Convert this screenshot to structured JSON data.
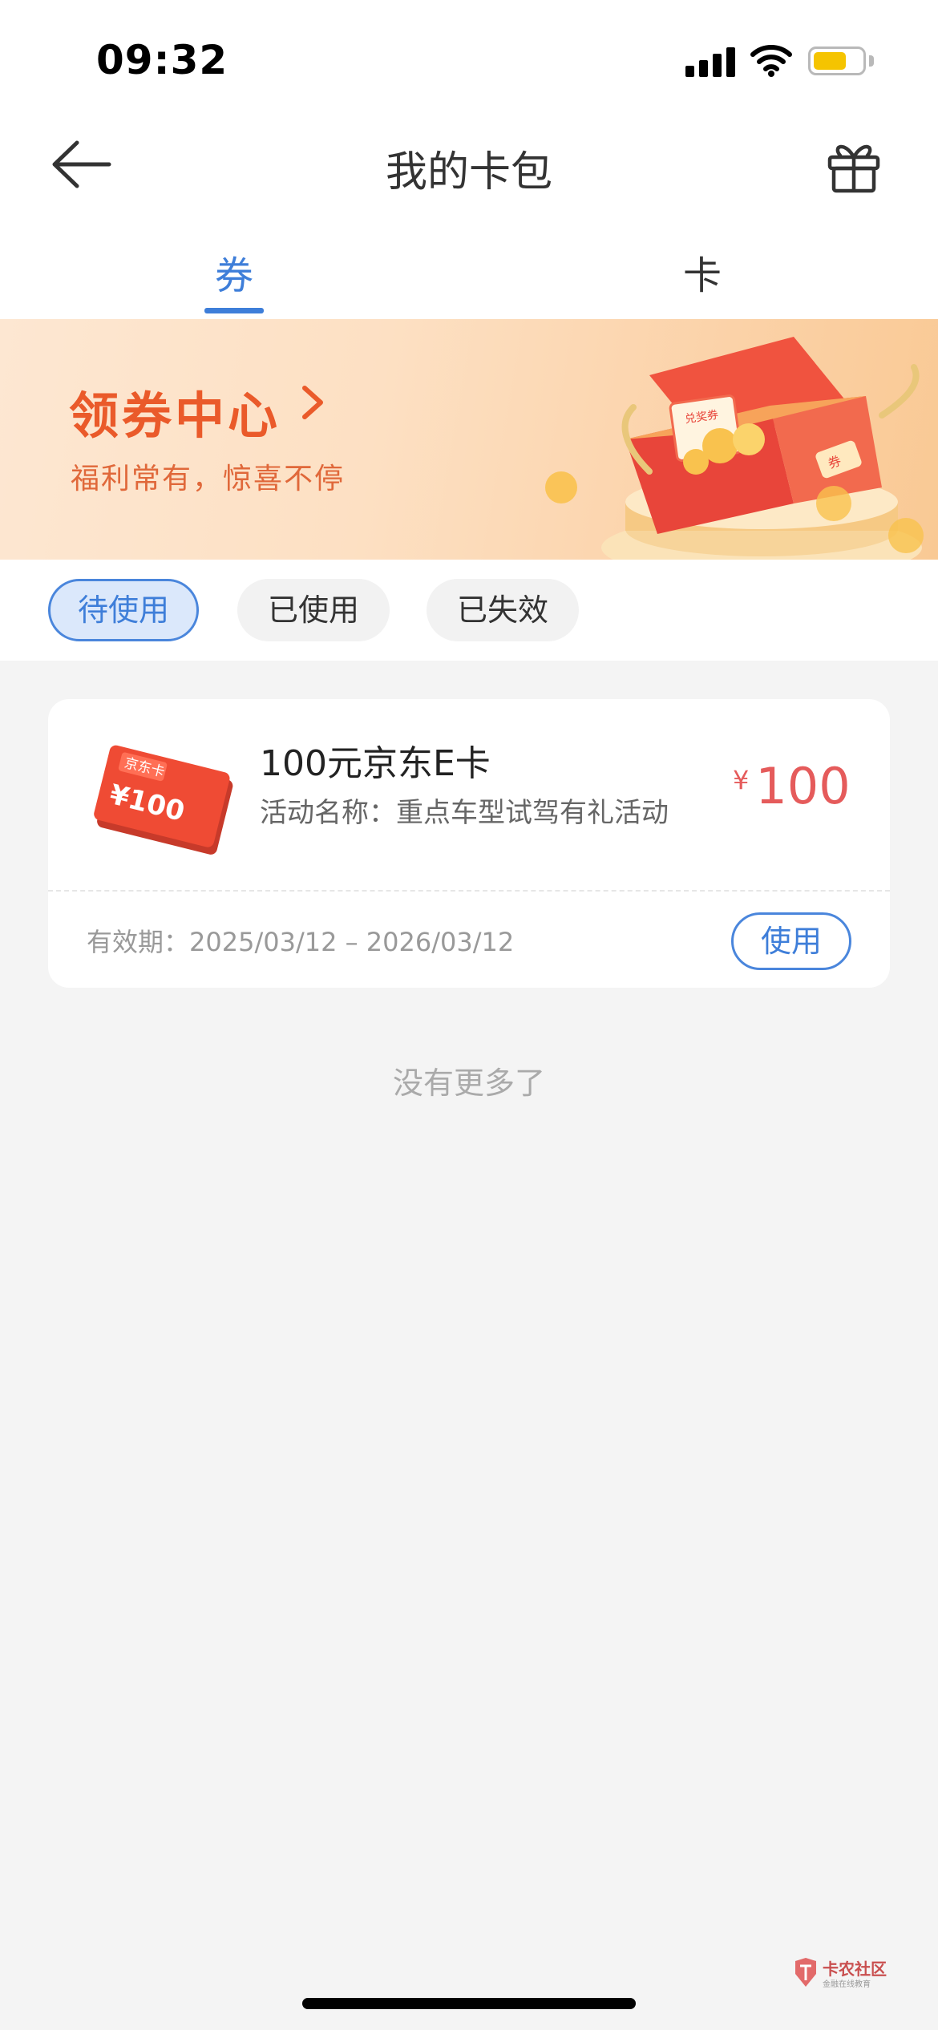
{
  "status_bar": {
    "time": "09:32"
  },
  "nav": {
    "title": "我的卡包"
  },
  "tabs": [
    {
      "label": "券",
      "active": true
    },
    {
      "label": "卡",
      "active": false
    }
  ],
  "banner": {
    "title": "领券中心",
    "subtitle": "福利常有，惊喜不停",
    "art_labels": {
      "envelope": "兑奖券",
      "ticket": "券"
    }
  },
  "filters": [
    {
      "label": "待使用",
      "active": true
    },
    {
      "label": "已使用",
      "active": false
    },
    {
      "label": "已失效",
      "active": false
    }
  ],
  "coupon": {
    "card_art": {
      "label": "京东卡",
      "amount": "¥100"
    },
    "title": "100元京东E卡",
    "activity": "活动名称：重点车型试驾有礼活动",
    "currency": "¥",
    "value": "100",
    "validity": "有效期：2025/03/12 – 2026/03/12",
    "use_label": "使用"
  },
  "list_end_text": "没有更多了",
  "watermark": {
    "name": "卡农社区",
    "tagline": "金融在线教育"
  },
  "colors": {
    "accent": "#3e7ed9",
    "price": "#e55b5b",
    "banner_title": "#ea5a2a",
    "background": "#f4f4f4"
  }
}
